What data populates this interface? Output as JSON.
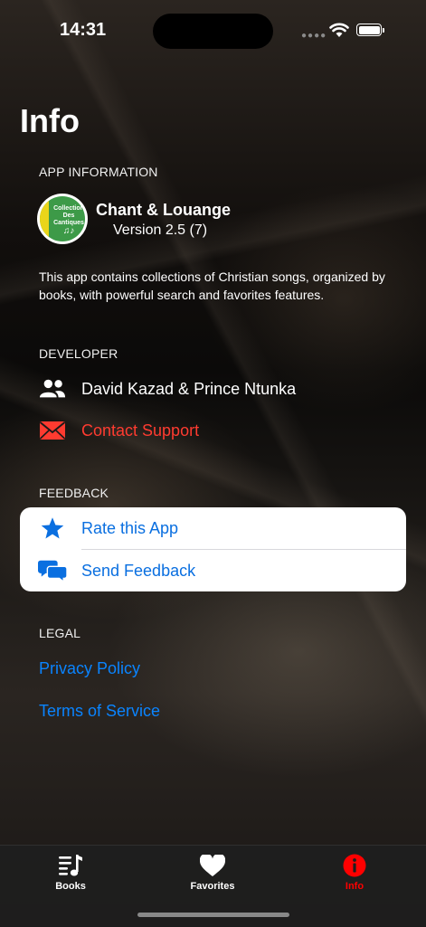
{
  "status_bar": {
    "time": "14:31"
  },
  "page": {
    "title": "Info"
  },
  "app_info": {
    "section": "APP INFORMATION",
    "icon_text": [
      "Collection",
      "Des",
      "Cantiques",
      "♫♪"
    ],
    "name": "Chant & Louange",
    "version": "Version 2.5 (7)",
    "description": "This app contains collections of Christian songs, organized by books, with powerful search and favorites features."
  },
  "developer": {
    "section": "DEVELOPER",
    "names": "David Kazad & Prince Ntunka",
    "support": "Contact Support"
  },
  "feedback": {
    "section": "FEEDBACK",
    "rate": "Rate this App",
    "send": "Send Feedback"
  },
  "legal": {
    "section": "LEGAL",
    "privacy": "Privacy Policy",
    "terms": "Terms of Service"
  },
  "tabs": [
    {
      "label": "Books",
      "icon": "music-list-icon",
      "active": false
    },
    {
      "label": "Favorites",
      "icon": "heart-icon",
      "active": false
    },
    {
      "label": "Info",
      "icon": "info-icon",
      "active": true
    }
  ],
  "colors": {
    "accent": "#0a84ff",
    "destructive": "#ff3b30",
    "active_tab": "#ff0000"
  }
}
